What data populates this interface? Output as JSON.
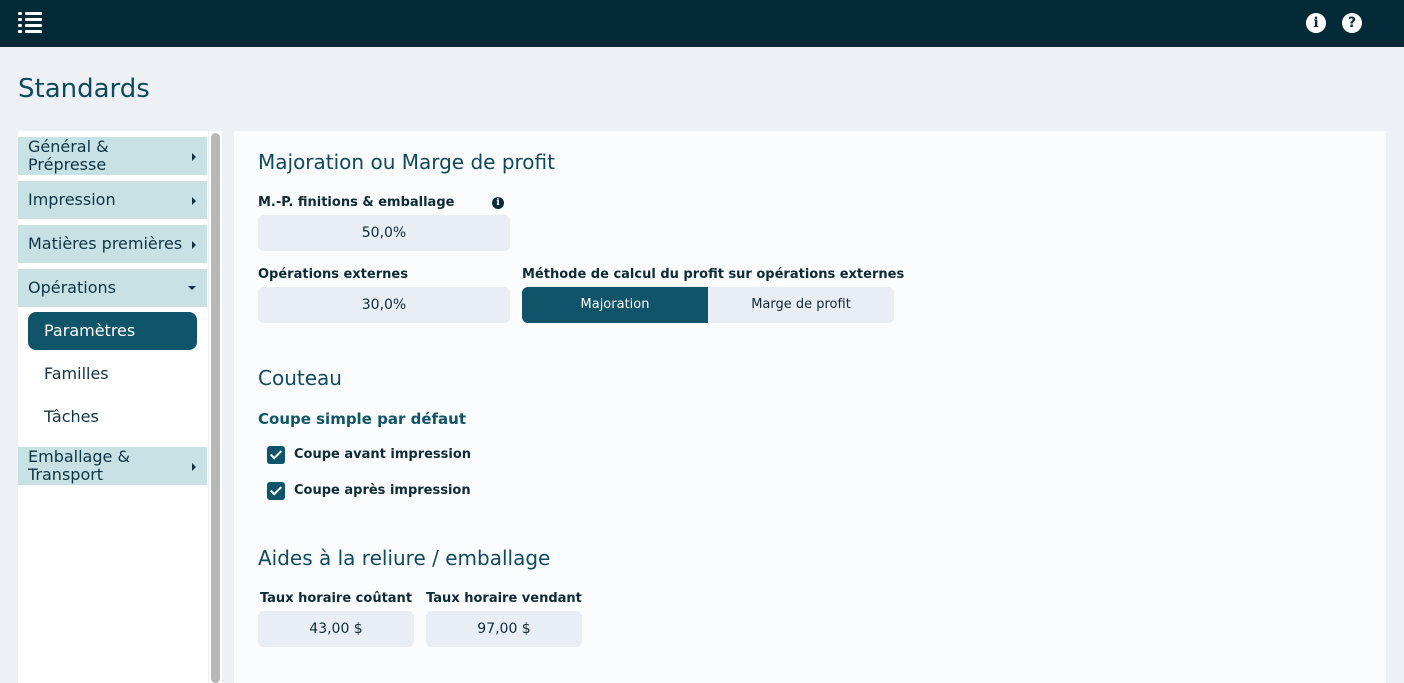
{
  "topbar": {
    "menu_icon": "menu-list-icon",
    "info_icon": "info-circle-icon",
    "help_icon": "question-circle-icon",
    "info_glyph": "i",
    "help_glyph": "?"
  },
  "page": {
    "title": "Standards"
  },
  "sidebar": {
    "items": [
      {
        "label_line1": "Général &",
        "label_line2": "Prépresse"
      },
      {
        "label": "Impression"
      },
      {
        "label": "Matières premières"
      },
      {
        "label": "Opérations"
      },
      {
        "label_line1": "Emballage &",
        "label_line2": "Transport"
      }
    ],
    "sub_items": [
      {
        "label": "Paramètres",
        "active": true
      },
      {
        "label": "Familles"
      },
      {
        "label": "Tâches"
      }
    ]
  },
  "markup": {
    "title": "Majoration ou Marge de profit",
    "mp_label": "M.-P. finitions & emballage",
    "mp_value": "50,0%",
    "ext_label": "Opérations externes",
    "ext_value": "30,0%",
    "method_label": "Méthode de calcul du profit sur opérations externes",
    "method_options": [
      "Majoration",
      "Marge de profit"
    ],
    "method_selected": "Majoration",
    "info_glyph": "i"
  },
  "couteau": {
    "title": "Couteau",
    "subtitle": "Coupe simple par défaut",
    "options": [
      {
        "label": "Coupe avant impression",
        "checked": true
      },
      {
        "label": "Coupe après impression",
        "checked": true
      }
    ]
  },
  "reliure": {
    "title": "Aides à la reliure / emballage",
    "cost_label": "Taux horaire coûtant",
    "cost_value": "43,00 $",
    "sell_label": "Taux horaire vendant",
    "sell_value": "97,00 $"
  },
  "colors": {
    "topbar": "#032a36",
    "accent": "#0f5468",
    "sidebar_item": "#c8e1e5",
    "background": "#edf1f5"
  }
}
